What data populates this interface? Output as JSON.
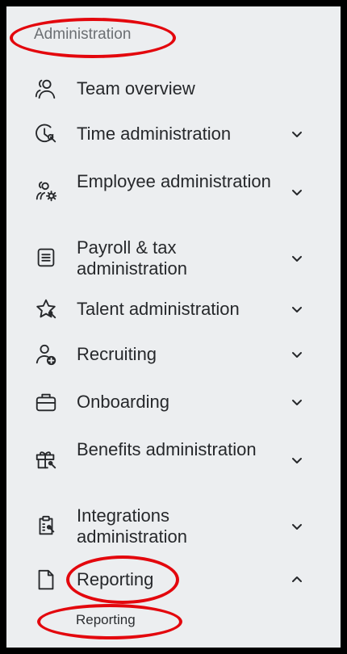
{
  "sidebar": {
    "section_title": "Administration",
    "items": [
      {
        "label": "Team overview",
        "icon": "team-icon",
        "chevron": "none"
      },
      {
        "label": "Time administration",
        "icon": "time-admin-icon",
        "chevron": "down"
      },
      {
        "label": "Employee administration",
        "icon": "employee-admin-icon",
        "chevron": "down"
      },
      {
        "label": "Payroll & tax administration",
        "icon": "payroll-icon",
        "chevron": "down"
      },
      {
        "label": "Talent administration",
        "icon": "talent-icon",
        "chevron": "down"
      },
      {
        "label": "Recruiting",
        "icon": "recruiting-icon",
        "chevron": "down"
      },
      {
        "label": "Onboarding",
        "icon": "onboarding-icon",
        "chevron": "down"
      },
      {
        "label": "Benefits administration",
        "icon": "benefits-icon",
        "chevron": "down"
      },
      {
        "label": "Integrations administration",
        "icon": "integrations-icon",
        "chevron": "down"
      },
      {
        "label": "Reporting",
        "icon": "reporting-icon",
        "chevron": "up"
      }
    ],
    "subitems": [
      {
        "label": "Reporting"
      }
    ]
  },
  "colors": {
    "panel_background": "#eceef0",
    "frame": "#000000",
    "highlight": "#e3070d",
    "text": "#26282b",
    "section_text": "#6b6f73"
  }
}
